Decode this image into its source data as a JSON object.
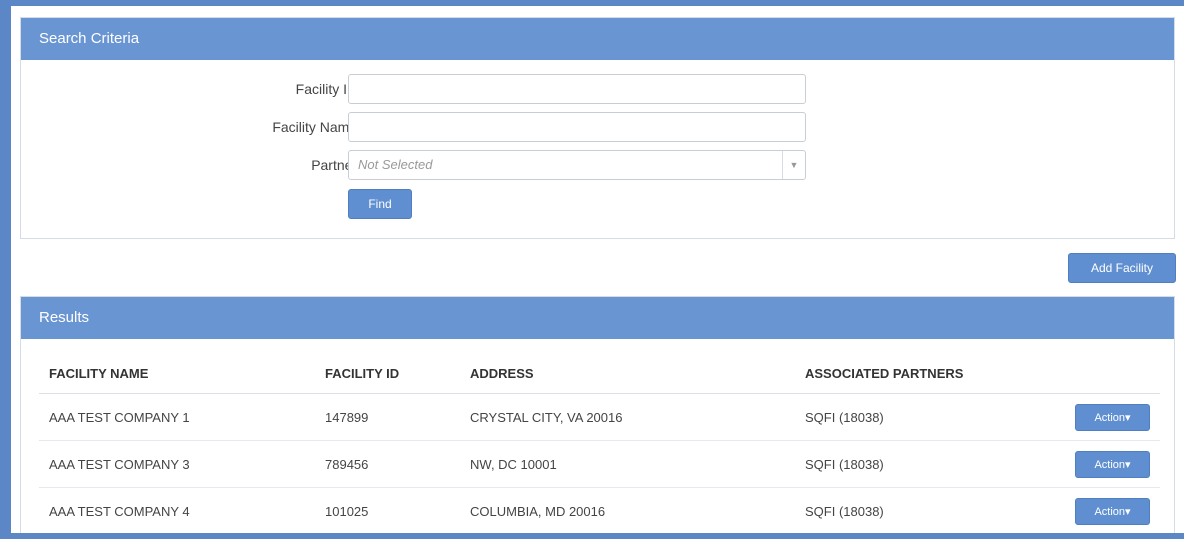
{
  "search_panel": {
    "title": "Search Criteria",
    "facility_id": {
      "label": "Facility ID:",
      "value": ""
    },
    "facility_name": {
      "label": "Facility Name:",
      "value": ""
    },
    "partner": {
      "label": "Partner:",
      "selected": "Not Selected"
    },
    "find_label": "Find"
  },
  "add_facility_label": "Add Facility",
  "results_panel": {
    "title": "Results",
    "columns": [
      "FACILITY NAME",
      "FACILITY ID",
      "ADDRESS",
      "ASSOCIATED PARTNERS"
    ],
    "rows": [
      {
        "name": "AAA TEST COMPANY 1",
        "id": "147899",
        "address": "CRYSTAL CITY, VA 20016",
        "partners": "SQFI (18038)",
        "action": "Action"
      },
      {
        "name": "AAA TEST COMPANY 3",
        "id": "789456",
        "address": "NW, DC 10001",
        "partners": "SQFI (18038)",
        "action": "Action"
      },
      {
        "name": "AAA TEST COMPANY 4",
        "id": "101025",
        "address": "COLUMBIA, MD 20016",
        "partners": "SQFI (18038)",
        "action": "Action"
      }
    ]
  },
  "colors": {
    "header": "#6a95d3",
    "button": "#5f8fd0",
    "frame": "#5b87c7"
  }
}
